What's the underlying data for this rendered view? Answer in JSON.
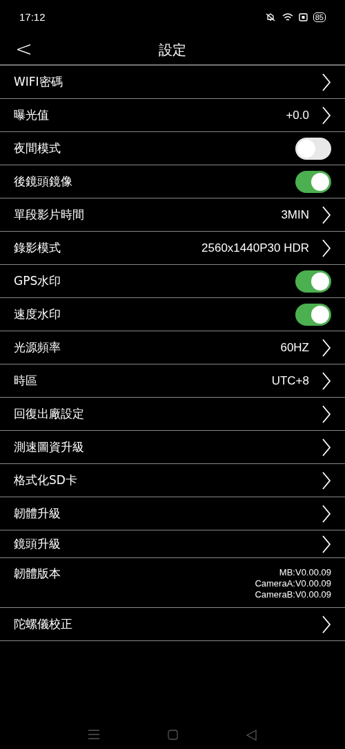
{
  "status_bar": {
    "time": "17:12",
    "battery": "85"
  },
  "header": {
    "back": "<",
    "title": "設定"
  },
  "rows": [
    {
      "kind": "link",
      "label": "WIFI密碼"
    },
    {
      "kind": "link",
      "label": "曝光值",
      "value": "+0.0"
    },
    {
      "kind": "toggle",
      "label": "夜間模式",
      "on": false
    },
    {
      "kind": "toggle",
      "label": "後鏡頭鏡像",
      "on": true
    },
    {
      "kind": "link",
      "label": "單段影片時間",
      "value": "3MIN"
    },
    {
      "kind": "link",
      "label": "錄影模式",
      "value": "2560x1440P30 HDR"
    },
    {
      "kind": "toggle",
      "label": "GPS水印",
      "on": true
    },
    {
      "kind": "toggle",
      "label": "速度水印",
      "on": true
    },
    {
      "kind": "link",
      "label": "光源頻率",
      "value": "60HZ"
    },
    {
      "kind": "link",
      "label": "時區",
      "value": "UTC+8"
    },
    {
      "kind": "link",
      "label": "回復出廠設定"
    },
    {
      "kind": "link",
      "label": "測速圖資升級"
    },
    {
      "kind": "link",
      "label": "格式化SD卡"
    },
    {
      "kind": "link",
      "label": "韌體升級"
    },
    {
      "kind": "link",
      "label": "鏡頭升級",
      "short": true
    },
    {
      "kind": "info",
      "label": "韌體版本",
      "lines": [
        "MB:V0.00.09",
        "CameraA:V0.00.09",
        "CameraB:V0.00.09"
      ]
    },
    {
      "kind": "link",
      "label": "陀螺儀校正"
    }
  ]
}
